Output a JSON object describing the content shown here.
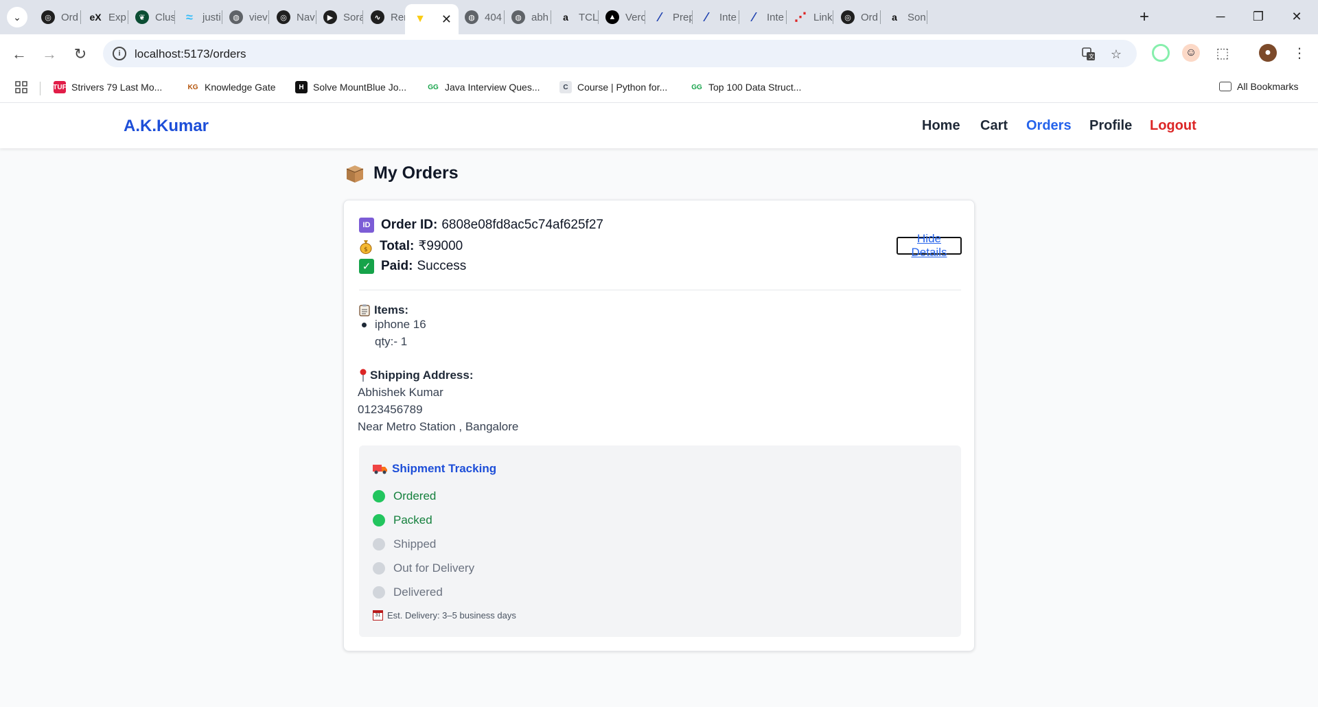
{
  "browser": {
    "tabs": [
      {
        "title": "Ord",
        "fav": "ai",
        "color": "#1f1f1f"
      },
      {
        "title": "Exp",
        "fav": "eX",
        "color": "#ffffff"
      },
      {
        "title": "Clus",
        "fav": "leaf",
        "color": "#0b4d33"
      },
      {
        "title": "justi",
        "fav": "wind",
        "color": "#38bdf8"
      },
      {
        "title": "viev",
        "fav": "globe",
        "color": "#5f6368"
      },
      {
        "title": "Nav",
        "fav": "ai",
        "color": "#1f1f1f"
      },
      {
        "title": "Sora",
        "fav": "play",
        "color": "#1f1f1f"
      },
      {
        "title": "Ren",
        "fav": "render",
        "color": "#1f1f1f"
      },
      {
        "title": "",
        "fav": "vite",
        "color": "#a855f7",
        "active": true
      },
      {
        "title": "404",
        "fav": "globe",
        "color": "#5f6368"
      },
      {
        "title": "abh",
        "fav": "globe",
        "color": "#5f6368"
      },
      {
        "title": "TCL",
        "fav": "a",
        "color": "#ffffff"
      },
      {
        "title": "Verc",
        "fav": "vercel",
        "color": "#000000"
      },
      {
        "title": "Prep",
        "fav": "slash",
        "color": "#1e40af"
      },
      {
        "title": "Inte",
        "fav": "slash",
        "color": "#1e40af"
      },
      {
        "title": "Inte",
        "fav": "slash",
        "color": "#1e40af"
      },
      {
        "title": "Link",
        "fav": "dots",
        "color": "#dc2626"
      },
      {
        "title": "Ord",
        "fav": "ai",
        "color": "#1f1f1f"
      },
      {
        "title": "Son",
        "fav": "a",
        "color": "#ffffff"
      }
    ],
    "url": "localhost:5173/orders",
    "bookmarks": [
      {
        "label": "Strivers 79 Last Mo...",
        "fav": "TUF",
        "bg": "#e11d48",
        "fg": "#ffffff"
      },
      {
        "label": "Knowledge Gate",
        "fav": "KG",
        "bg": "#ffffff",
        "fg": "#b45309"
      },
      {
        "label": "Solve MountBlue Jo...",
        "fav": "H",
        "bg": "#111111",
        "fg": "#ffffff"
      },
      {
        "label": "Java Interview Ques...",
        "fav": "GG",
        "bg": "#ffffff",
        "fg": "#16a34a"
      },
      {
        "label": "Course | Python for...",
        "fav": "C",
        "bg": "#e5e7eb",
        "fg": "#374151"
      },
      {
        "label": "Top 100 Data Struct...",
        "fav": "GG",
        "bg": "#ffffff",
        "fg": "#16a34a"
      }
    ],
    "all_bookmarks": "All Bookmarks"
  },
  "app": {
    "brand": "A.K.Kumar",
    "nav": [
      "Home",
      "Cart",
      "Orders",
      "Profile",
      "Logout"
    ],
    "page_title": "My Orders"
  },
  "order": {
    "id_label": "Order ID:",
    "id_value": "6808e08fd8ac5c74af625f27",
    "total_label": "Total:",
    "total_value": "₹99000",
    "paid_label": "Paid:",
    "paid_value": "Success",
    "toggle_label": "Hide Details",
    "items_label": "Items:",
    "item_name": "iphone 16",
    "item_qty": "qty:- 1",
    "shipping_label": "Shipping Address:",
    "ship_name": "Abhishek Kumar",
    "ship_phone": "0123456789",
    "ship_address": "Near Metro Station , Bangalore"
  },
  "tracking": {
    "title": "Shipment Tracking",
    "steps": [
      {
        "label": "Ordered",
        "done": true
      },
      {
        "label": "Packed",
        "done": true
      },
      {
        "label": "Shipped",
        "done": false
      },
      {
        "label": "Out for Delivery",
        "done": false
      },
      {
        "label": "Delivered",
        "done": false
      }
    ],
    "estimate": "Est. Delivery: 3–5 business days",
    "done_color": "#22c55e",
    "pending_color": "#d1d5db"
  },
  "colors": {
    "accent": "#2563eb",
    "brand": "#1d4ed8",
    "logout": "#dc2626"
  }
}
